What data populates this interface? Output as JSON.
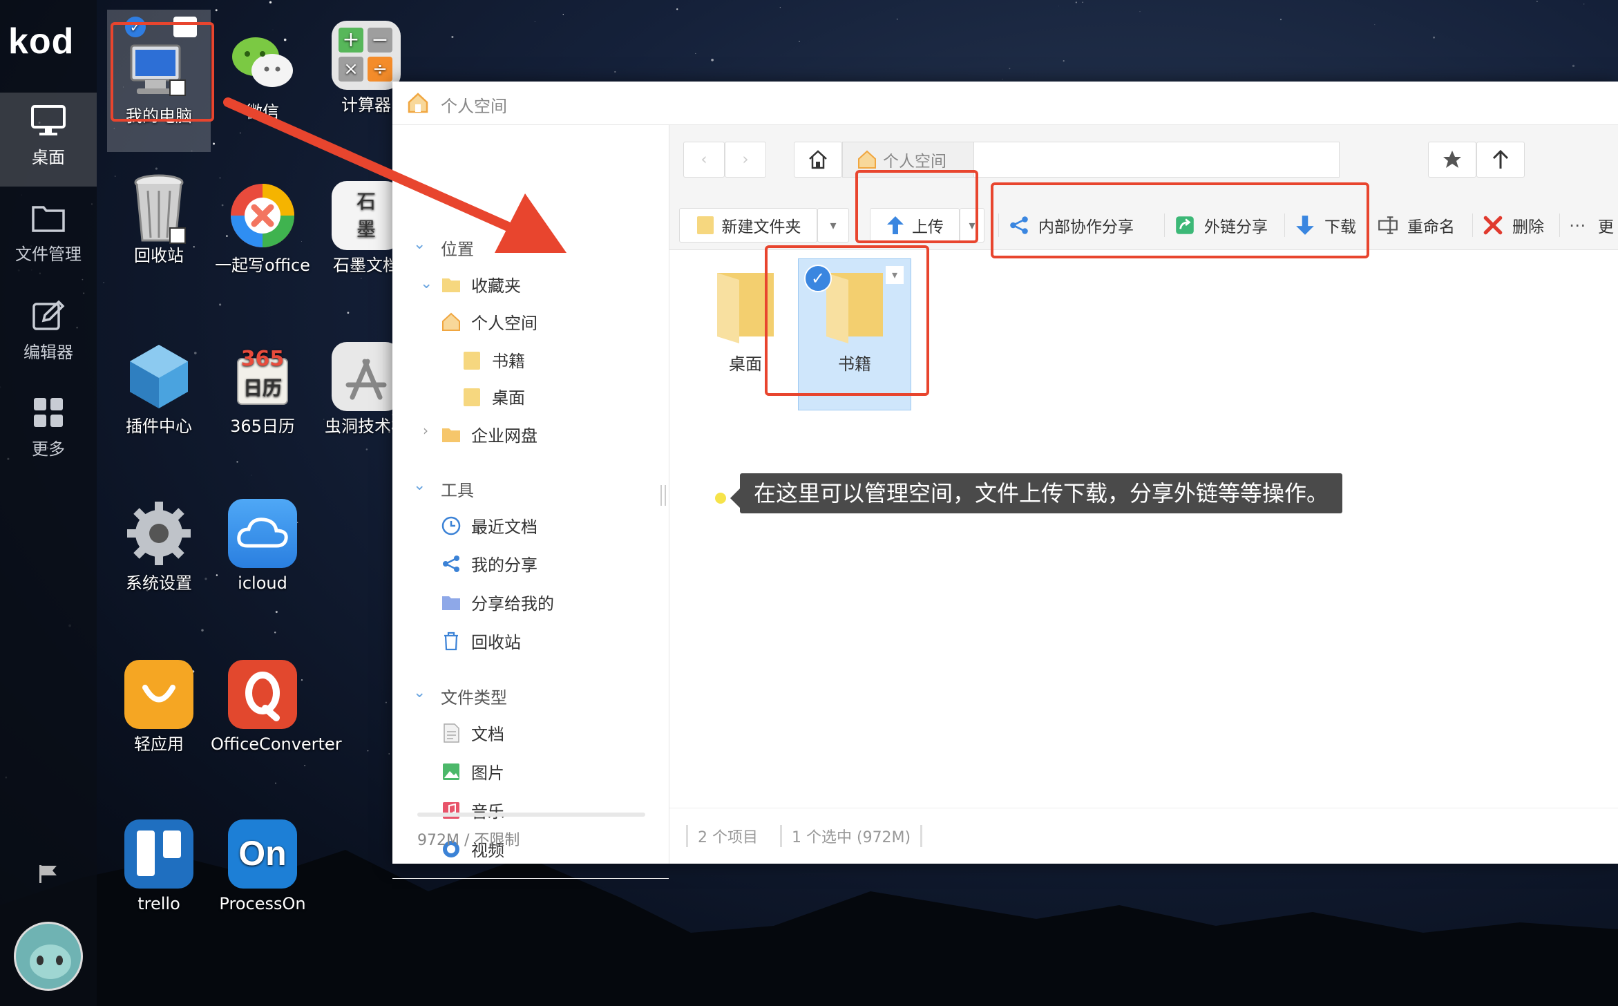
{
  "dock": {
    "logo": "kod",
    "items": [
      {
        "label": "桌面",
        "icon": "desktop-icon"
      },
      {
        "label": "文件管理",
        "icon": "folder-icon"
      },
      {
        "label": "编辑器",
        "icon": "edit-icon"
      },
      {
        "label": "更多",
        "icon": "grid-icon"
      }
    ]
  },
  "desktop": {
    "icons": [
      {
        "label": "我的电脑",
        "icon": "computer-icon"
      },
      {
        "label": "微信",
        "icon": "wechat-icon"
      },
      {
        "label": "计算器",
        "icon": "calculator-icon"
      },
      {
        "label": "回收站",
        "icon": "recycle-bin-icon"
      },
      {
        "label": "一起写office",
        "icon": "office-icon"
      },
      {
        "label": "石墨文档",
        "icon": "shimo-icon"
      },
      {
        "label": "插件中心",
        "icon": "plugin-icon"
      },
      {
        "label": "365日历",
        "icon": "calendar-icon"
      },
      {
        "label": "虫洞技术栈",
        "icon": "appstore-icon"
      },
      {
        "label": "系统设置",
        "icon": "gear-icon"
      },
      {
        "label": "icloud",
        "icon": "cloud-icon"
      },
      {
        "label": "轻应用",
        "icon": "bag-icon"
      },
      {
        "label": "OfficeConverter",
        "icon": "office-converter-icon"
      },
      {
        "label": "trello",
        "icon": "trello-icon"
      },
      {
        "label": "ProcessOn",
        "icon": "processon-icon"
      }
    ]
  },
  "window": {
    "title": "个人空间",
    "sidebar": {
      "section_location": "位置",
      "favorites": "收藏夹",
      "personal": "个人空间",
      "books": "书籍",
      "desktop": "桌面",
      "enterprise": "企业网盘",
      "section_tools": "工具",
      "recent": "最近文档",
      "my_share": "我的分享",
      "shared_to_me": "分享给我的",
      "recycle": "回收站",
      "section_types": "文件类型",
      "doc": "文档",
      "image": "图片",
      "music": "音乐",
      "video": "视频",
      "quota": "972M / 不限制"
    },
    "address": {
      "path": "个人空间"
    },
    "toolbar": {
      "new_folder": "新建文件夹",
      "upload": "上传",
      "internal_share": "内部协作分享",
      "external_share": "外链分享",
      "download": "下载",
      "rename": "重命名",
      "delete": "删除",
      "more": "更"
    },
    "files": [
      {
        "name": "桌面",
        "selected": false
      },
      {
        "name": "书籍",
        "selected": true
      }
    ],
    "tooltip": "在这里可以管理空间，文件上传下载，分享外链等等操作。",
    "status": {
      "count": "2 个项目",
      "selected": "1 个选中 (972M)"
    }
  },
  "colors": {
    "highlight": "#e8452e",
    "accent": "#2f7de1",
    "folder": "#f6d77f"
  }
}
